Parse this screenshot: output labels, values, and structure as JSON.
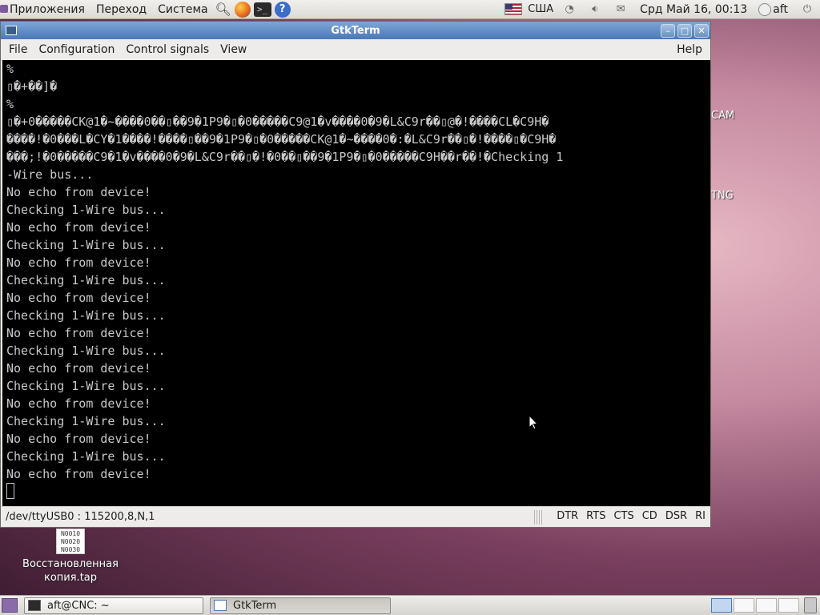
{
  "top_panel": {
    "menus": [
      "Приложения",
      "Переход",
      "Система"
    ],
    "keyboard_layout": "США",
    "clock": "Срд Май 16, 00:13",
    "user": "aft"
  },
  "desktop": {
    "partial_labels": [
      "CAM",
      "TNG"
    ],
    "file_icon_text": [
      "N0010",
      "N0020",
      "N0030"
    ],
    "file_label_line1": "Восстановленная",
    "file_label_line2": "копия.tap"
  },
  "window": {
    "title": "GtkTerm",
    "menu": {
      "file": "File",
      "configuration": "Configuration",
      "control_signals": "Control signals",
      "view": "View",
      "help": "Help"
    },
    "terminal_lines": [
      "%",
      "▯�+��]�",
      "%",
      "▯�+0�����CK@1�~����0��▯��9�1P9�▯�0�����C9@1�v����0�9�L&C9r��▯@�!����CL�C9H�",
      "����!�0���L�CY�1����!����▯��9�1P9�▯�0�����CK@1�~����0�:�L&C9r��▯�!����▯�C9H�",
      "���;!�0�����C9�1�v����0�9�L&C9r��▯�!�0��▯��9�1P9�▯�0�����C9H��r��!�Checking 1",
      "-Wire bus...",
      "No echo from device!",
      "Checking 1-Wire bus...",
      "No echo from device!",
      "Checking 1-Wire bus...",
      "No echo from device!",
      "Checking 1-Wire bus...",
      "No echo from device!",
      "Checking 1-Wire bus...",
      "No echo from device!",
      "Checking 1-Wire bus...",
      "No echo from device!",
      "Checking 1-Wire bus...",
      "No echo from device!",
      "Checking 1-Wire bus...",
      "No echo from device!",
      "Checking 1-Wire bus...",
      "No echo from device!"
    ],
    "status": {
      "port": "/dev/ttyUSB0 : 115200,8,N,1",
      "signals": [
        "DTR",
        "RTS",
        "CTS",
        "CD",
        "DSR",
        "RI"
      ]
    }
  },
  "bottom_panel": {
    "tasks": [
      "aft@CNC: ~",
      "GtkTerm"
    ]
  },
  "colors": {
    "terminal_bg": "#000000",
    "terminal_fg": "#c8c8c8",
    "titlebar": "#5b86c2"
  }
}
